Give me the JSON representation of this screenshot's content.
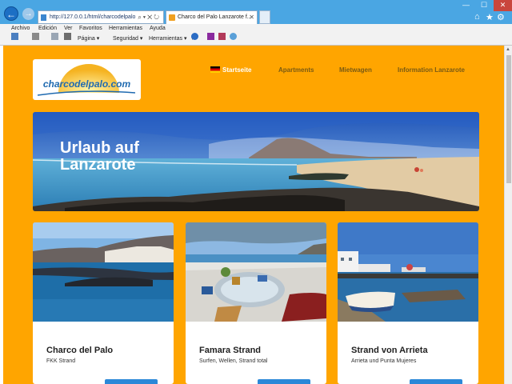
{
  "browser": {
    "address": "http://127.0.0.1/html/charcodelpalo",
    "tab_title": "Charco del Palo Lanzarote f...",
    "menu": [
      "Archivo",
      "Edición",
      "Ver",
      "Favoritos",
      "Herramientas",
      "Ayuda"
    ],
    "commands": [
      "Página ▾",
      "Seguridad ▾",
      "Herramientas ▾"
    ]
  },
  "site": {
    "logo_text": "charcodelpalo.com",
    "nav": [
      "Startseite",
      "Apartments",
      "Mietwagen",
      "Information Lanzarote"
    ],
    "hero": {
      "line1": "Urlaub auf",
      "line2": "Lanzarote"
    },
    "cards": [
      {
        "title": "Charco del Palo",
        "subtitle": "FKK Strand"
      },
      {
        "title": "Famara Strand",
        "subtitle": "Surfen, Wellen, Strand total"
      },
      {
        "title": "Strand von Arrieta",
        "subtitle": "Arrieta und Punta Mujeres"
      }
    ]
  },
  "colors": {
    "page_bg": "#ffa500",
    "brand_blue": "#1f6ab0",
    "titlebar": "#4aa6e3"
  }
}
